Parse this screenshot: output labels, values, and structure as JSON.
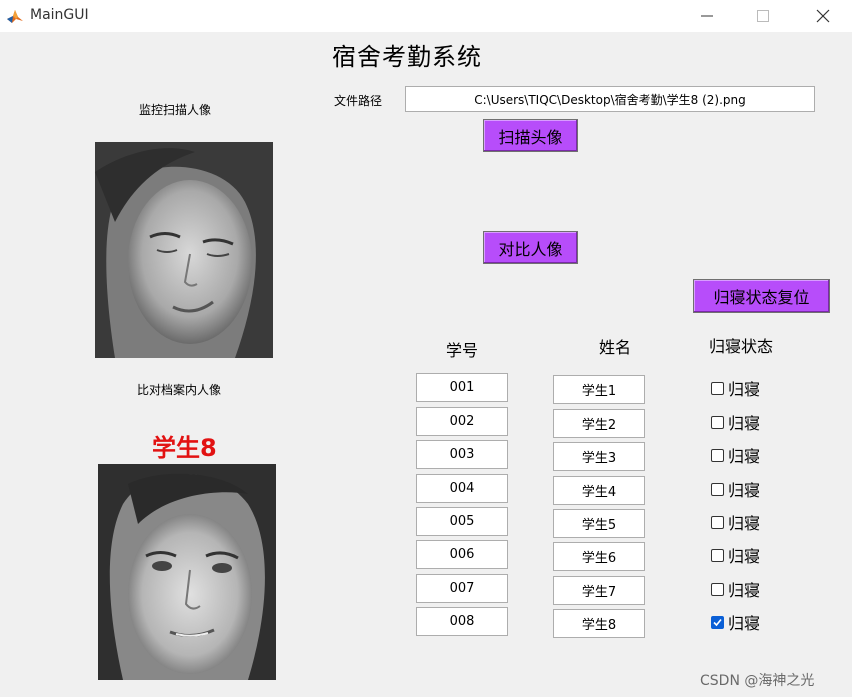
{
  "window": {
    "title": "MainGUI"
  },
  "main_title": "宿舍考勤系统",
  "scan_label": "监控扫描人像",
  "archive_label": "比对档案内人像",
  "matched_student": "学生8",
  "path_label": "文件路径",
  "path_value": "C:\\Users\\TIQC\\Desktop\\宿舍考勤\\学生8 (2).png",
  "buttons": {
    "scan": "扫描头像",
    "compare": "对比人像",
    "reset": "归寝状态复位"
  },
  "table": {
    "headers": {
      "id": "学号",
      "name": "姓名",
      "status": "归寝状态"
    },
    "rows": [
      {
        "id": "001",
        "name": "学生1",
        "status_label": "归寝",
        "checked": false
      },
      {
        "id": "002",
        "name": "学生2",
        "status_label": "归寝",
        "checked": false
      },
      {
        "id": "003",
        "name": "学生3",
        "status_label": "归寝",
        "checked": false
      },
      {
        "id": "004",
        "name": "学生4",
        "status_label": "归寝",
        "checked": false
      },
      {
        "id": "005",
        "name": "学生5",
        "status_label": "归寝",
        "checked": false
      },
      {
        "id": "006",
        "name": "学生6",
        "status_label": "归寝",
        "checked": false
      },
      {
        "id": "007",
        "name": "学生7",
        "status_label": "归寝",
        "checked": false
      },
      {
        "id": "008",
        "name": "学生8",
        "status_label": "归寝",
        "checked": true
      }
    ]
  },
  "watermark": "CSDN @海神之光",
  "colors": {
    "button_bg": "#b74dfa",
    "name_color": "#e21212",
    "checkbox_checked": "#0a5fd6"
  }
}
